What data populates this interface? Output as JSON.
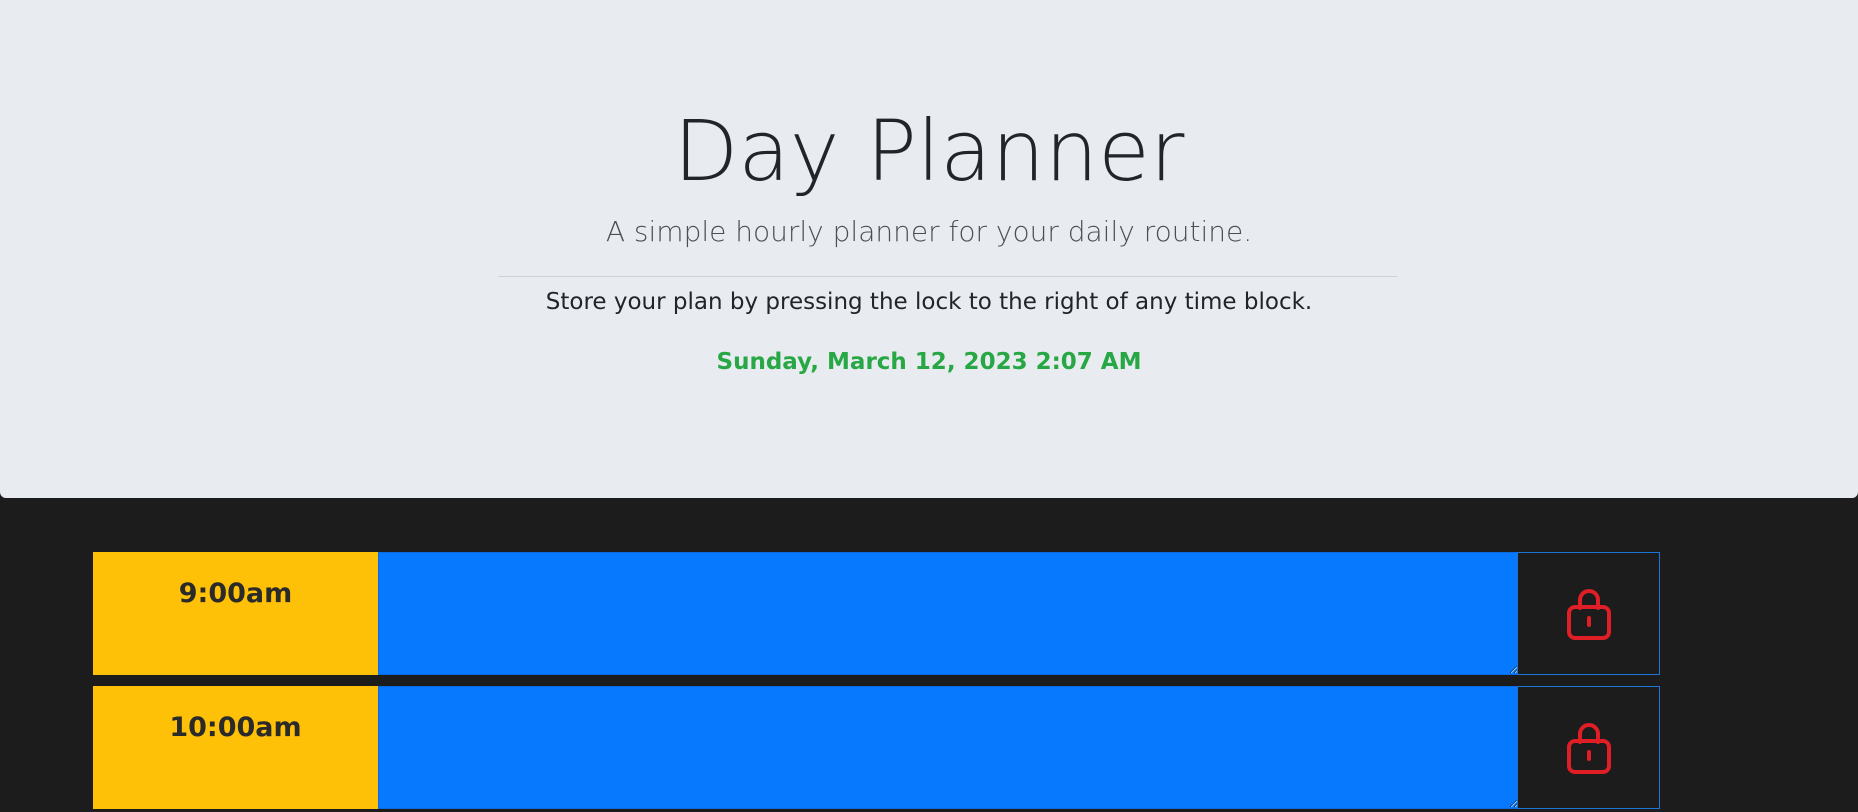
{
  "header": {
    "title": "Day Planner",
    "lead": "A simple hourly planner for your daily routine.",
    "instructions": "Store your plan by pressing the lock to the right of any time block.",
    "current_day": "Sunday, March 12, 2023 2:07 AM"
  },
  "time_blocks": [
    {
      "hour": "9:00am",
      "description": "",
      "save_icon": "lock-icon"
    },
    {
      "hour": "10:00am",
      "description": "",
      "save_icon": "lock-icon"
    }
  ],
  "colors": {
    "header_bg": "#e8ecf0",
    "page_bg": "#1c1c1c",
    "current_day": "#28a745",
    "hour_bg": "#ffc107",
    "future_block": "#0779ff",
    "lock_icon": "#e01e26",
    "save_border": "#1d74d9"
  }
}
